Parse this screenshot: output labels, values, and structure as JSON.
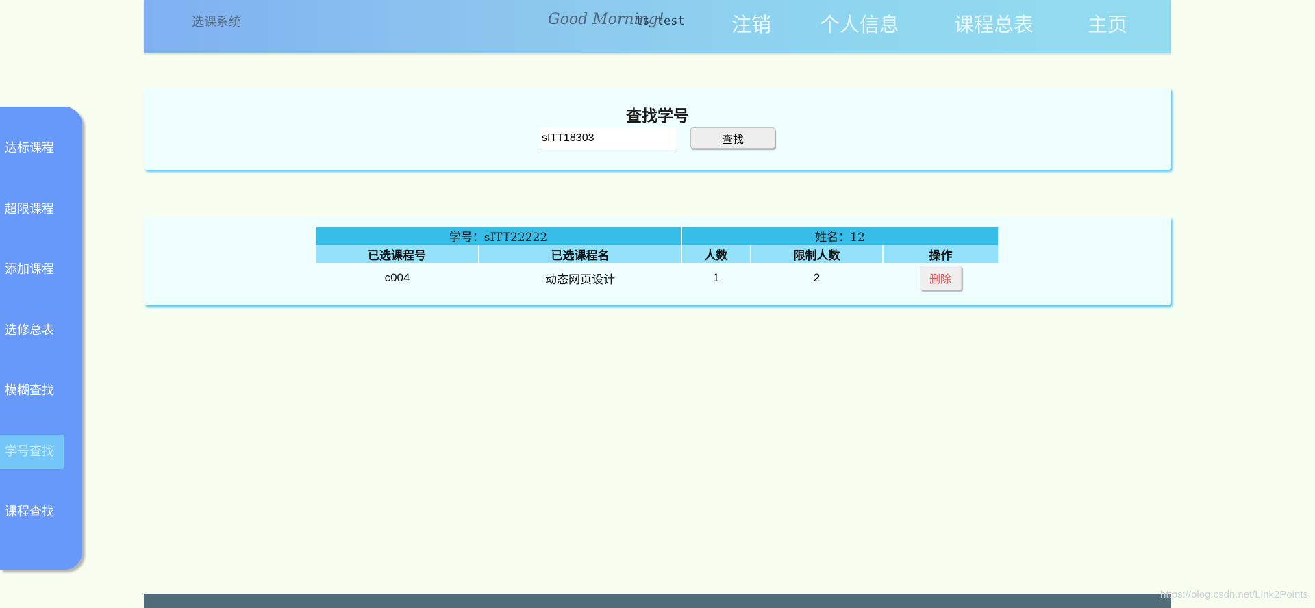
{
  "header": {
    "site_title": "选课系统",
    "greeting": "Good Morning!",
    "username": "ts_test",
    "nav": [
      "注销",
      "个人信息",
      "课程总表",
      "主页"
    ]
  },
  "sidebar": {
    "items": [
      {
        "label": "达标课程"
      },
      {
        "label": "超限课程"
      },
      {
        "label": "添加课程"
      },
      {
        "label": "选修总表"
      },
      {
        "label": "模糊查找"
      },
      {
        "label": "学号查找",
        "active": true
      },
      {
        "label": "课程查找"
      }
    ]
  },
  "search": {
    "title": "查找学号",
    "input_value": "sITT18303",
    "button_label": "查找"
  },
  "result": {
    "student_id_text": "学号：sITT22222",
    "student_name_text": "姓名：12",
    "columns": [
      "已选课程号",
      "已选课程名",
      "人数",
      "限制人数",
      "操作"
    ],
    "rows": [
      {
        "course_id": "c004",
        "course_name": "动态网页设计",
        "count": "1",
        "limit": "2",
        "action_label": "删除"
      }
    ]
  },
  "watermark": "https://blog.csdn.net/Link2Points",
  "colors": {
    "background": "#f8fff0",
    "sidebar": "#6799fb",
    "sidebar_active": "#75c6f8",
    "table_info_row": "#38bde9",
    "table_header_row": "#94e2fa",
    "delete_text": "#e34a4a",
    "footer": "#4f6c78"
  }
}
